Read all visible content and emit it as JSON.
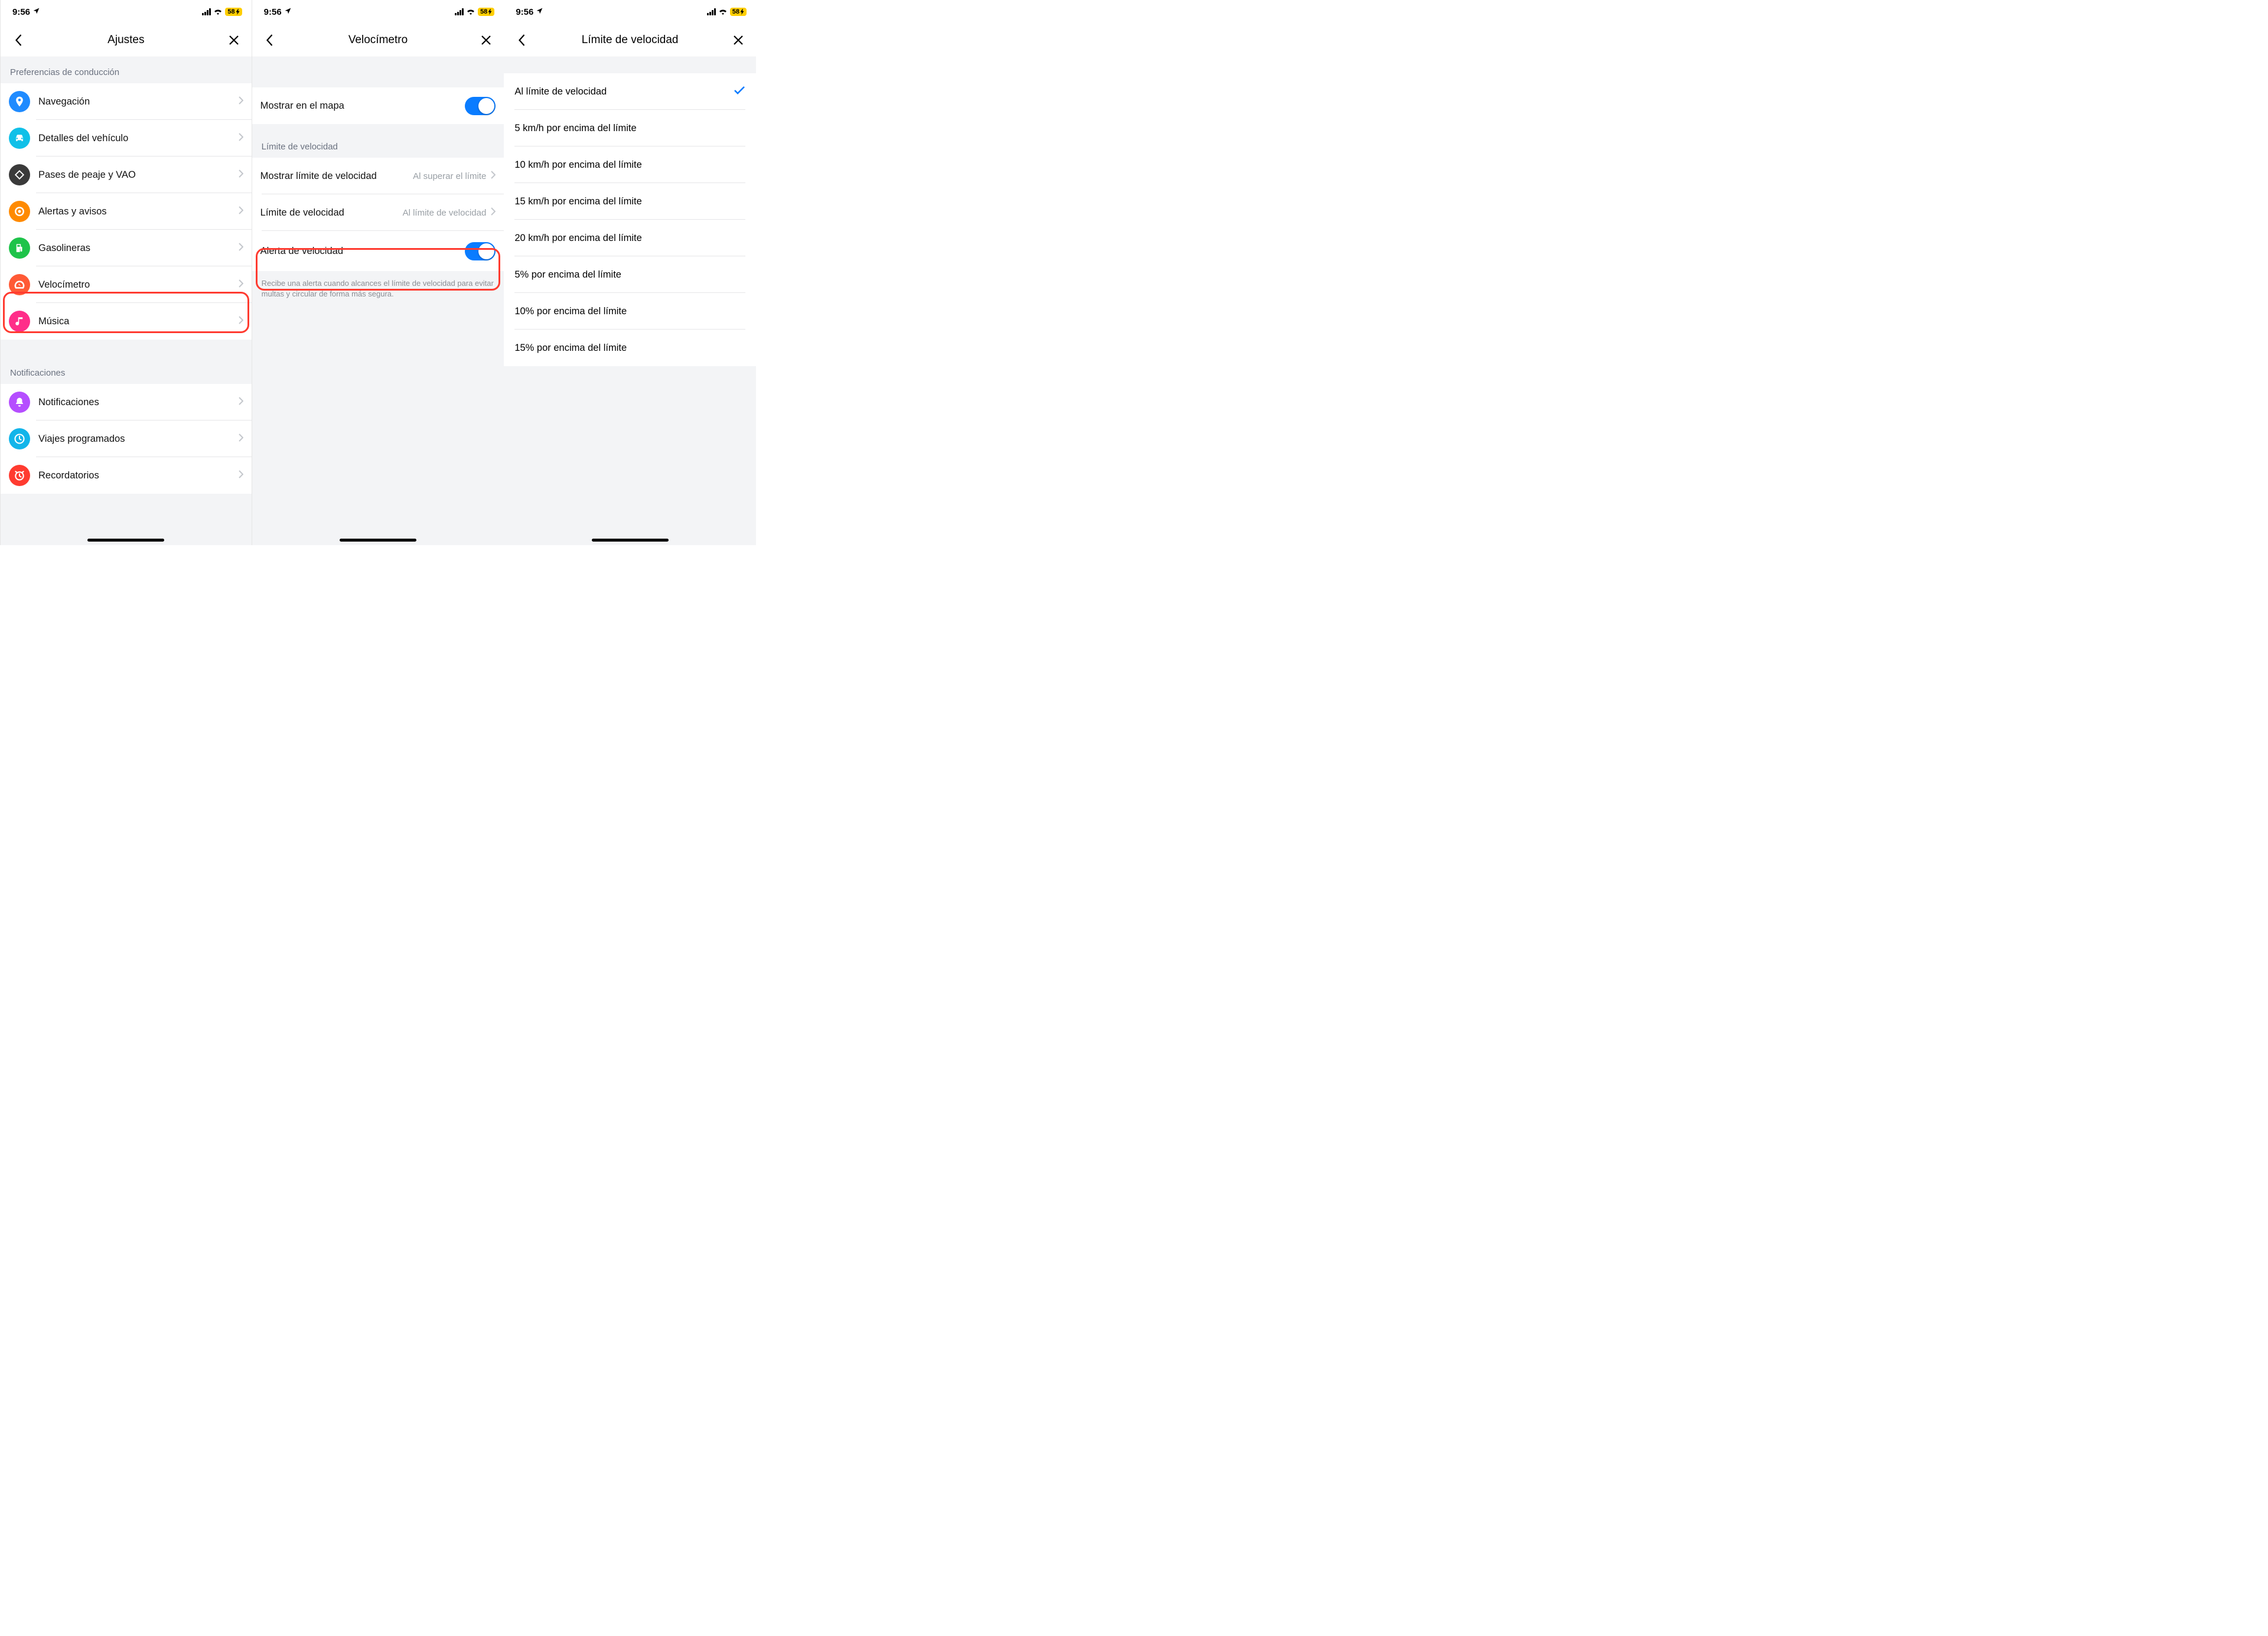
{
  "status": {
    "time": "9:56",
    "battery": "58"
  },
  "s1": {
    "title": "Ajustes",
    "section1": "Preferencias de conducción",
    "items1": [
      {
        "label": "Navegación",
        "icon": "map",
        "color": "#1f8bff"
      },
      {
        "label": "Detalles del vehículo",
        "icon": "car",
        "color": "#10c0e8"
      },
      {
        "label": "Pases de peaje y VAO",
        "icon": "diamond",
        "color": "#3a3a3a"
      },
      {
        "label": "Alertas y avisos",
        "icon": "target",
        "color": "#ff8a00"
      },
      {
        "label": "Gasolineras",
        "icon": "fuel",
        "color": "#1ec34a"
      },
      {
        "label": "Velocímetro",
        "icon": "gauge",
        "color": "#ff5a36"
      },
      {
        "label": "Música",
        "icon": "music",
        "color": "#ff2e89"
      }
    ],
    "section2": "Notificaciones",
    "items2": [
      {
        "label": "Notificaciones",
        "icon": "bell",
        "color": "#b54eff"
      },
      {
        "label": "Viajes programados",
        "icon": "clock",
        "color": "#12b5ea"
      },
      {
        "label": "Recordatorios",
        "icon": "alarm",
        "color": "#ff3b30"
      }
    ]
  },
  "s2": {
    "title": "Velocímetro",
    "row1": "Mostrar en el mapa",
    "section": "Límite de velocidad",
    "row2_label": "Mostrar límite de velocidad",
    "row2_value": "Al superar el límite",
    "row3_label": "Límite de velocidad",
    "row3_value": "Al límite de velocidad",
    "row4_label": "Alerta de velocidad",
    "footnote": "Recibe una alerta cuando alcances el límite de velocidad para evitar multas y circular de forma más segura."
  },
  "s3": {
    "title": "Límite de velocidad",
    "options": [
      "Al límite de velocidad",
      "5 km/h por encima del límite",
      "10 km/h por encima del límite",
      "15 km/h por encima del límite",
      "20 km/h por encima del límite",
      "5% por encima del límite",
      "10% por encima del límite",
      "15% por encima del límite"
    ],
    "selected_index": 0
  }
}
